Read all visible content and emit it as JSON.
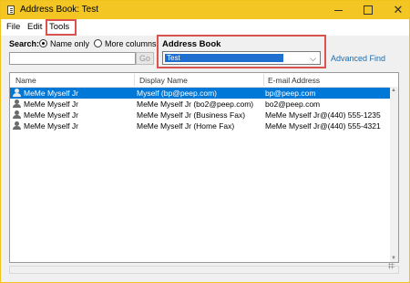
{
  "window": {
    "title": "Address Book: Test"
  },
  "menu": {
    "file": "File",
    "edit": "Edit",
    "tools": "Tools"
  },
  "search": {
    "label": "Search:",
    "option_name_only": "Name only",
    "option_more_columns": "More columns",
    "selected_option": "Name only",
    "input_value": "",
    "go_label": "Go"
  },
  "address_book": {
    "label": "Address Book",
    "selected": "Test"
  },
  "advanced_find": "Advanced Find",
  "columns": {
    "name": "Name",
    "display_name": "Display Name",
    "email": "E-mail Address"
  },
  "rows": [
    {
      "name": "MeMe Myself Jr",
      "display": "Myself (bp@peep.com)",
      "email": "bp@peep.com",
      "selected": true
    },
    {
      "name": "MeMe Myself Jr",
      "display": "MeMe Myself Jr (bo2@peep.com)",
      "email": "bo2@peep.com",
      "selected": false
    },
    {
      "name": "MeMe Myself Jr",
      "display": "MeMe Myself Jr (Business Fax)",
      "email": "MeMe Myself Jr@(440) 555-1235",
      "selected": false
    },
    {
      "name": "MeMe Myself Jr",
      "display": "MeMe Myself Jr (Home Fax)",
      "email": "MeMe Myself Jr@(440) 555-4321",
      "selected": false
    }
  ],
  "colors": {
    "titlebar": "#f3c623",
    "selection": "#0078d7",
    "highlight_box": "#d9534f",
    "link": "#1a6db0"
  }
}
